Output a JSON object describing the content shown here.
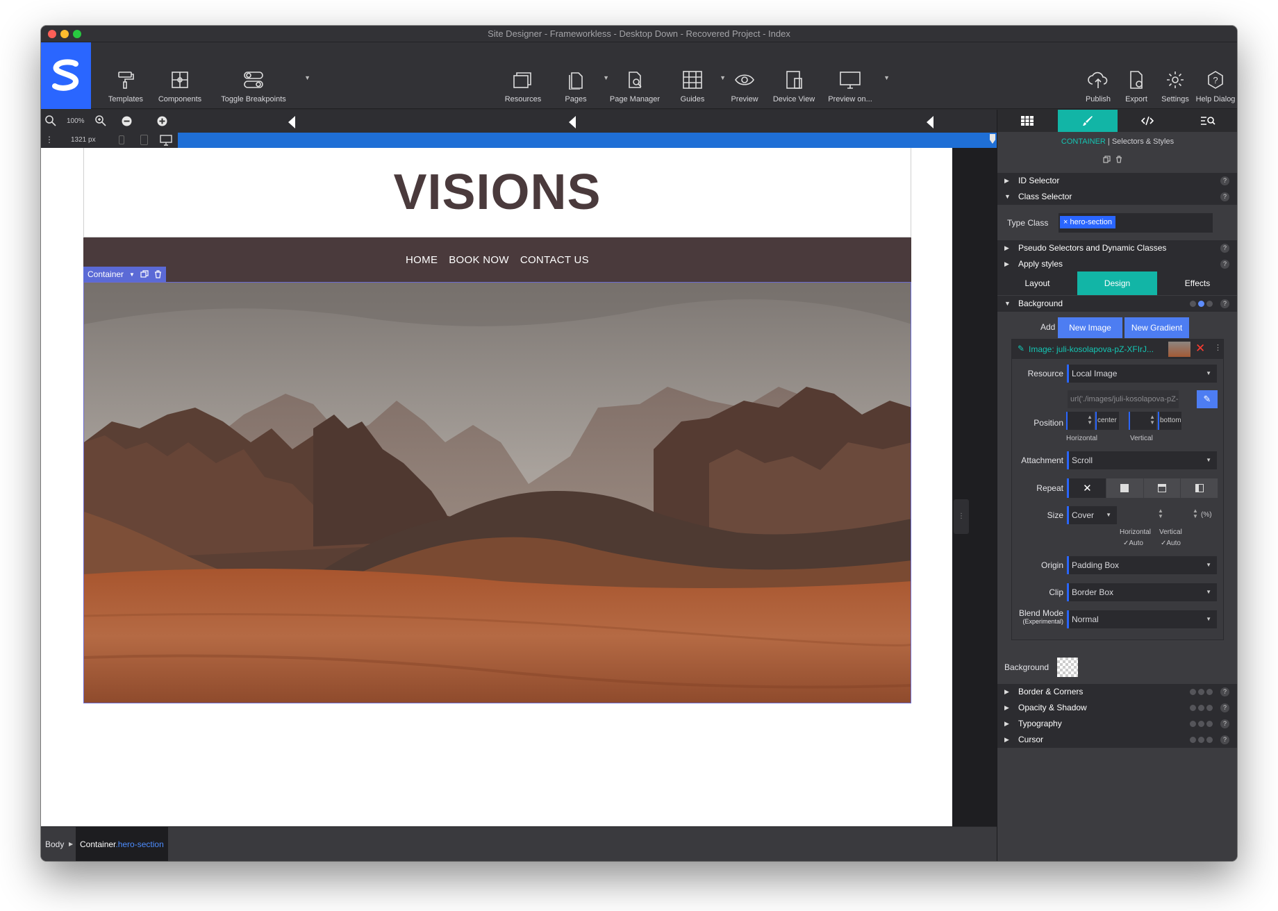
{
  "window": {
    "title": "Site Designer - Frameworkless - Desktop Down - Recovered Project - Index"
  },
  "toolbar": {
    "templates": "Templates",
    "components": "Components",
    "toggle_breakpoints": "Toggle Breakpoints",
    "resources": "Resources",
    "pages": "Pages",
    "page_manager": "Page Manager",
    "guides": "Guides",
    "preview": "Preview",
    "device_view": "Device View",
    "preview_on": "Preview on...",
    "publish": "Publish",
    "export": "Export",
    "settings": "Settings",
    "help": "Help Dialog"
  },
  "zoom": {
    "level": "100%",
    "width": "1321 px"
  },
  "site": {
    "logo": "VISIONS",
    "nav": [
      "HOME",
      "BOOK NOW",
      "CONTACT US"
    ],
    "selected_tag": "Container"
  },
  "statusbar": {
    "body": "Body",
    "container": "Container",
    "container_class": ".hero-section"
  },
  "panel": {
    "header_kind": "CONTAINER",
    "header_rest": "| Selectors & Styles",
    "id_selector": "ID Selector",
    "class_selector": "Class Selector",
    "type_class_label": "Type Class",
    "class_chip": "hero-section",
    "pseudo": "Pseudo Selectors and Dynamic Classes",
    "apply_styles": "Apply styles",
    "subtabs": [
      "Layout",
      "Design",
      "Effects"
    ],
    "background": "Background",
    "add_label": "Add",
    "new_image": "New Image",
    "new_gradient": "New Gradient",
    "image_name": "Image: juli-kosolapova-pZ-XFIrJ...",
    "resource_label": "Resource",
    "resource_value": "Local Image",
    "url_value": "url('./images/juli-kosolapova-pZ-",
    "position_label": "Position",
    "position_h": "center",
    "position_v": "bottom",
    "horizontal": "Horizontal",
    "vertical": "Vertical",
    "attachment_label": "Attachment",
    "attachment_value": "Scroll",
    "repeat_label": "Repeat",
    "size_label": "Size",
    "size_value": "Cover",
    "size_unit": "(%)",
    "auto": "Auto",
    "origin_label": "Origin",
    "origin_value": "Padding Box",
    "clip_label": "Clip",
    "clip_value": "Border Box",
    "blend_label": "Blend Mode",
    "blend_sub": "(Experimental)",
    "blend_value": "Normal",
    "bg_color_label": "Background",
    "border_corners": "Border & Corners",
    "opacity_shadow": "Opacity & Shadow",
    "typography": "Typography",
    "cursor": "Cursor"
  }
}
